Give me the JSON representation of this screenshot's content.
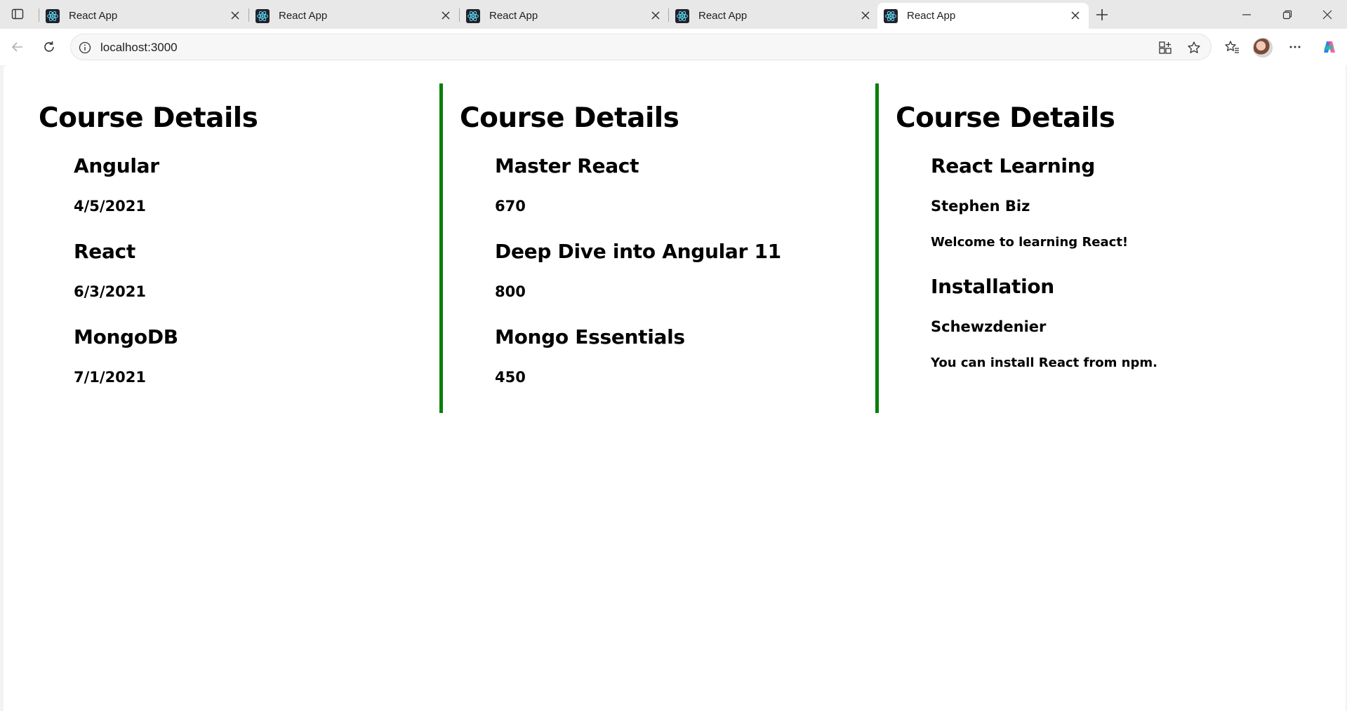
{
  "browser": {
    "tabs": [
      {
        "title": "React App",
        "active": false
      },
      {
        "title": "React App",
        "active": false
      },
      {
        "title": "React App",
        "active": false
      },
      {
        "title": "React App",
        "active": false
      },
      {
        "title": "React App",
        "active": true
      }
    ],
    "address_bar": {
      "url": "localhost:3000"
    },
    "accent_color": "#0a7f0a"
  },
  "panels": [
    {
      "heading": "Course Details",
      "items": [
        {
          "title": "Angular",
          "detail": "4/5/2021"
        },
        {
          "title": "React",
          "detail": "6/3/2021"
        },
        {
          "title": "MongoDB",
          "detail": "7/1/2021"
        }
      ]
    },
    {
      "heading": "Course Details",
      "items": [
        {
          "title": "Master React",
          "detail": "670"
        },
        {
          "title": "Deep Dive into Angular 11",
          "detail": "800"
        },
        {
          "title": "Mongo Essentials",
          "detail": "450"
        }
      ]
    },
    {
      "heading": "Course Details",
      "items": [
        {
          "title": "React Learning",
          "author": "Stephen Biz",
          "text": "Welcome to learning React!"
        },
        {
          "title": "Installation",
          "author": "Schewzdenier",
          "text": "You can install React from npm."
        }
      ]
    }
  ]
}
